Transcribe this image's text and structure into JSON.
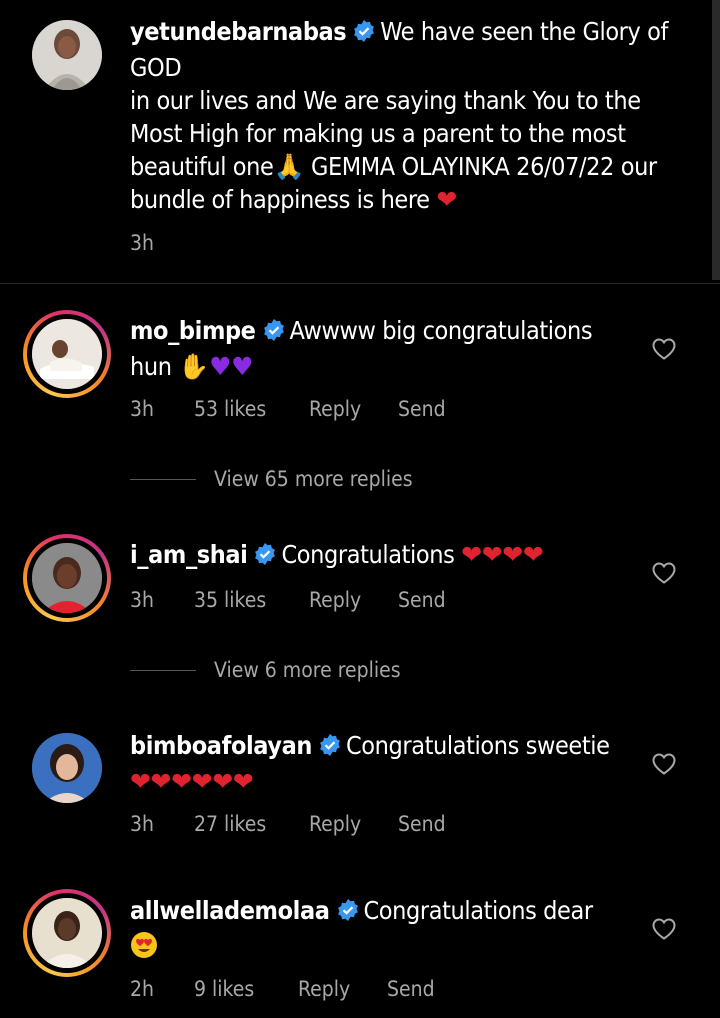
{
  "caption": {
    "username": "yetundebarnabas",
    "text_line1": "We have seen the Glory of GOD",
    "text_line2": "in our lives and We are saying thank You to the Most High for making us a parent to the most beautiful one",
    "text_line3": "GEMMA OLAYINKA 26/07/22 our bundle of happiness is here",
    "time": "3h"
  },
  "comments": [
    {
      "username": "mo_bimpe",
      "text": "Awwww big congratulations hun",
      "time": "3h",
      "likes": "53 likes",
      "reply": "Reply",
      "send": "Send",
      "view_replies": "View 65 more replies"
    },
    {
      "username": "i_am_shai",
      "text": "Congratulations",
      "time": "3h",
      "likes": "35 likes",
      "reply": "Reply",
      "send": "Send",
      "view_replies": "View 6 more replies"
    },
    {
      "username": "bimboafolayan",
      "text": "Congratulations sweetie",
      "time": "3h",
      "likes": "27 likes",
      "reply": "Reply",
      "send": "Send"
    },
    {
      "username": "allwellademolaa",
      "text": "Congratulations dear",
      "time": "2h",
      "likes": "9 likes",
      "reply": "Reply",
      "send": "Send"
    }
  ],
  "colors": {
    "background": "#000000",
    "secondary_text": "#a8a8a8",
    "verified_badge": "#3897f0",
    "heart_emoji": "#e0232e"
  }
}
